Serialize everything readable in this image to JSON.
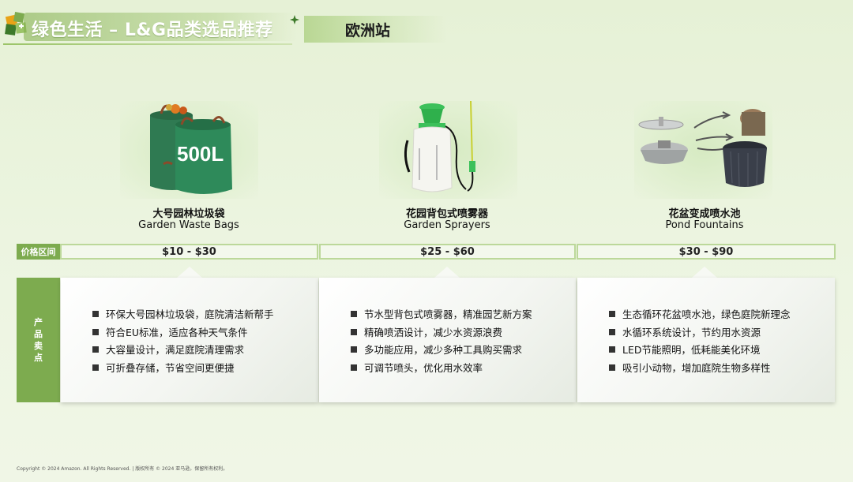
{
  "header": {
    "title": "绿色生活 – L&G品类选品推荐",
    "station": "欧洲站"
  },
  "products": [
    {
      "name_cn": "大号园林垃圾袋",
      "name_en": "Garden Waste Bags",
      "image_badge": "500L",
      "price": "$10 - $30",
      "points": [
        "环保大号园林垃圾袋，庭院清洁新帮手",
        "符合EU标准，适应各种天气条件",
        "大容量设计，满足庭院清理需求",
        "可折叠存储，节省空间更便捷"
      ]
    },
    {
      "name_cn": "花园背包式喷雾器",
      "name_en": "Garden Sprayers",
      "price": "$25 - $60",
      "points": [
        "节水型背包式喷雾器，精准园艺新方案",
        "精确喷洒设计，减少水资源浪费",
        "多功能应用，减少多种工具购买需求",
        "可调节喷头，优化用水效率"
      ]
    },
    {
      "name_cn": "花盆变成喷水池",
      "name_en": "Pond Fountains",
      "price": "$30 - $90",
      "points": [
        "生态循环花盆喷水池，绿色庭院新理念",
        "水循环系统设计，节约用水资源",
        "LED节能照明，低耗能美化环境",
        "吸引小动物，增加庭院生物多样性"
      ]
    }
  ],
  "labels": {
    "price_range": "价格区间",
    "selling_points": [
      "产",
      "品",
      "卖",
      "点"
    ]
  },
  "footer": "Copyright © 2024 Amazon. All Rights Reserved. | 版权所有 © 2024 亚马逊。保留所有权利。",
  "colors": {
    "accent": "#7dab4f",
    "border": "#bcd89a",
    "background": "#e6f1d6"
  }
}
